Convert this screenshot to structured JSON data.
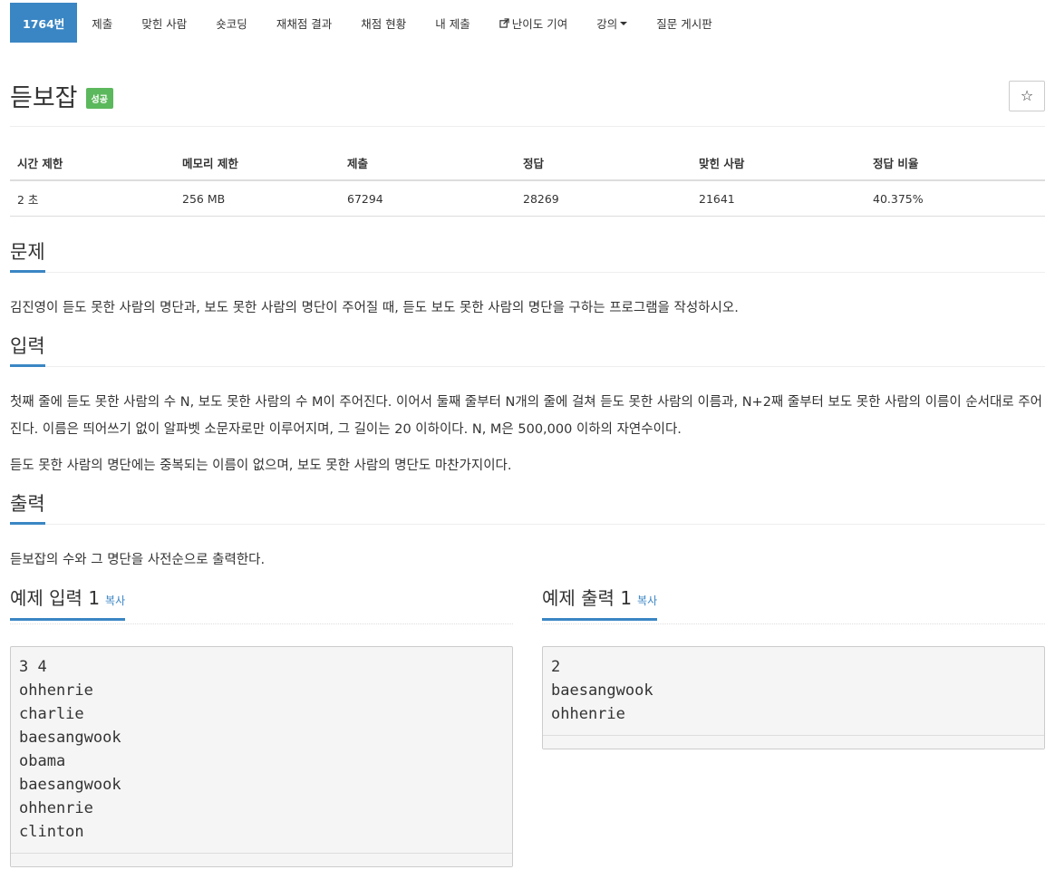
{
  "nav": {
    "items": [
      {
        "label": "1764번"
      },
      {
        "label": "제출"
      },
      {
        "label": "맞힌 사람"
      },
      {
        "label": "숏코딩"
      },
      {
        "label": "재채점 결과"
      },
      {
        "label": "채점 현황"
      },
      {
        "label": "내 제출"
      },
      {
        "label": "난이도 기여",
        "icon": "external-link-icon"
      },
      {
        "label": "강의"
      },
      {
        "label": "질문 게시판"
      }
    ]
  },
  "problem": {
    "title": "듣보잡",
    "badge": "성공",
    "star": "☆"
  },
  "info_table": {
    "headers": [
      "시간 제한",
      "메모리 제한",
      "제출",
      "정답",
      "맞힌 사람",
      "정답 비율"
    ],
    "values": [
      "2 초",
      "256 MB",
      "67294",
      "28269",
      "21641",
      "40.375%"
    ]
  },
  "sections": {
    "description": {
      "title": "문제",
      "text": "김진영이 듣도 못한 사람의 명단과, 보도 못한 사람의 명단이 주어질 때, 듣도 보도 못한 사람의 명단을 구하는 프로그램을 작성하시오."
    },
    "input": {
      "title": "입력",
      "p1": "첫째 줄에 듣도 못한 사람의 수 N, 보도 못한 사람의 수 M이 주어진다. 이어서 둘째 줄부터 N개의 줄에 걸쳐 듣도 못한 사람의 이름과, N+2째 줄부터 보도 못한 사람의 이름이 순서대로 주어진다. 이름은 띄어쓰기 없이 알파벳 소문자로만 이루어지며, 그 길이는 20 이하이다. N, M은 500,000 이하의 자연수이다.",
      "p2": "듣도 못한 사람의 명단에는 중복되는 이름이 없으며, 보도 못한 사람의 명단도 마찬가지이다."
    },
    "output": {
      "title": "출력",
      "text": "듣보잡의 수와 그 명단을 사전순으로 출력한다."
    }
  },
  "samples": {
    "input": {
      "title": "예제 입력 1",
      "copy": "복사",
      "data": "3 4\nohhenrie\ncharlie\nbaesangwook\nobama\nbaesangwook\nohhenrie\nclinton"
    },
    "output": {
      "title": "예제 출력 1",
      "copy": "복사",
      "data": "2\nbaesangwook\nohhenrie"
    }
  },
  "colors": {
    "accent": "#3a86c4",
    "success": "#5cb85c"
  }
}
